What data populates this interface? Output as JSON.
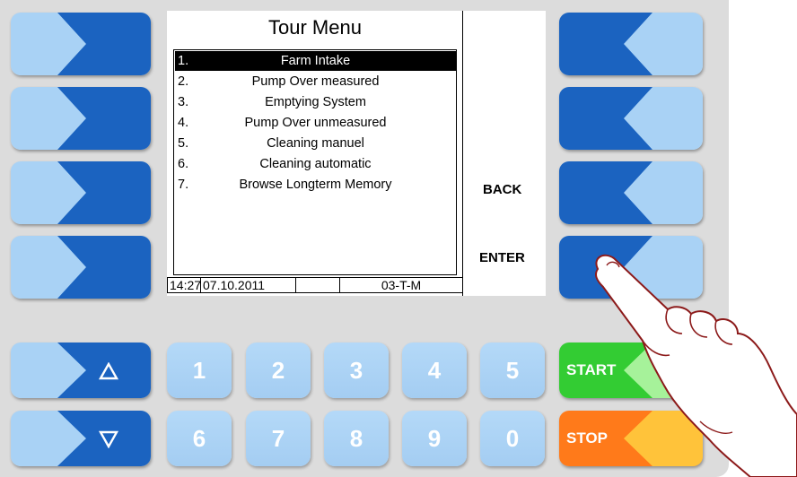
{
  "screen": {
    "title": "Tour Menu",
    "menu_items": [
      {
        "number": "1.",
        "label": "Farm Intake",
        "selected": true
      },
      {
        "number": "2.",
        "label": "Pump Over measured"
      },
      {
        "number": "3.",
        "label": "Emptying System"
      },
      {
        "number": "4.",
        "label": "Pump Over unmeasured"
      },
      {
        "number": "5.",
        "label": "Cleaning manuel"
      },
      {
        "number": "6.",
        "label": "Cleaning automatic"
      },
      {
        "number": "7.",
        "label": "Browse Longterm Memory"
      }
    ],
    "softkey_labels": {
      "back": "BACK",
      "enter": "ENTER"
    },
    "status": {
      "time": "14:27",
      "date": "07.10.2011",
      "code": "03-T-M"
    }
  },
  "keys": {
    "digits": [
      "1",
      "2",
      "3",
      "4",
      "5",
      "6",
      "7",
      "8",
      "9",
      "0"
    ],
    "start_label": "START",
    "stop_label": "STOP",
    "up_icon": "up-triangle-icon",
    "down_icon": "down-triangle-icon"
  },
  "colors": {
    "key_light": "#a9d2f5",
    "key_dark": "#1b63c0",
    "start": "#33cc33",
    "stop": "#ff7a1a",
    "stop_arrow": "#ffc33a"
  }
}
